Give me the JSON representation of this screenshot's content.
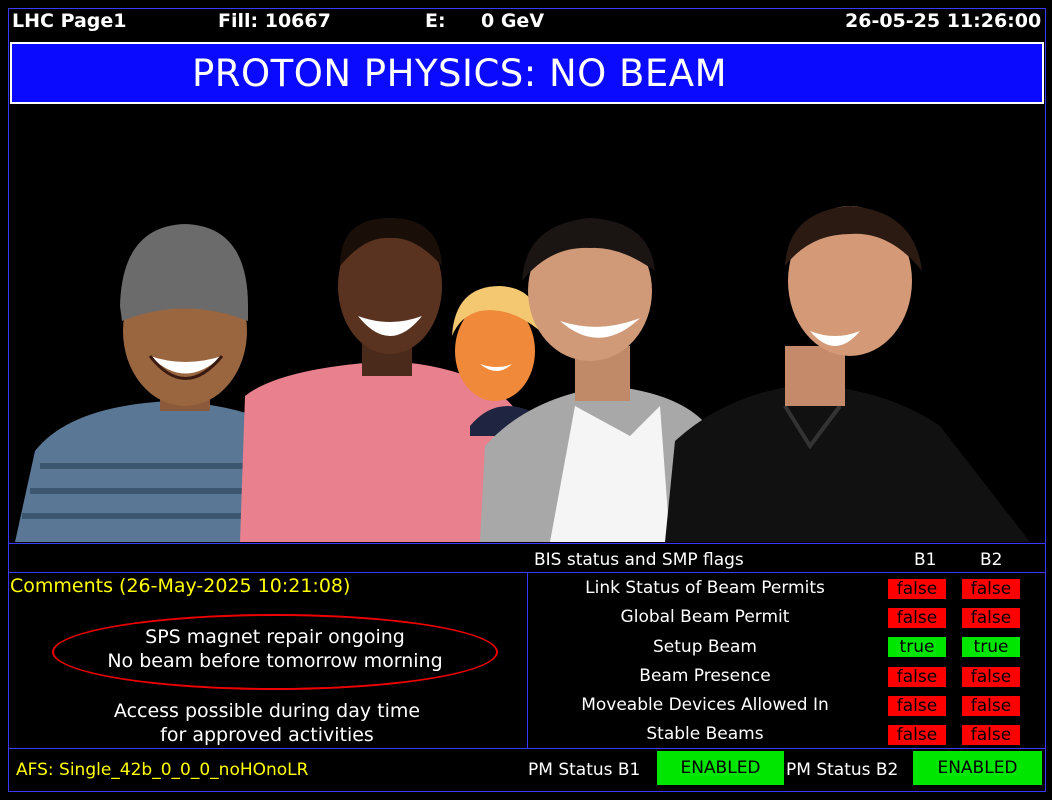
{
  "header": {
    "page": "LHC Page1",
    "fill": "Fill: 10667",
    "energy_label": "E:",
    "energy_value": "0 GeV",
    "datetime": "26-05-25 11:26:00"
  },
  "banner": {
    "title": "PROTON PHYSICS: NO BEAM"
  },
  "bis": {
    "title": "BIS status and SMP flags",
    "col_b1": "B1",
    "col_b2": "B2",
    "rows": [
      {
        "label": "Link Status of Beam Permits",
        "b1": "false",
        "b2": "false"
      },
      {
        "label": "Global Beam Permit",
        "b1": "false",
        "b2": "false"
      },
      {
        "label": "Setup Beam",
        "b1": "true",
        "b2": "true"
      },
      {
        "label": "Beam Presence",
        "b1": "false",
        "b2": "false"
      },
      {
        "label": "Moveable Devices Allowed In",
        "b1": "false",
        "b2": "false"
      },
      {
        "label": "Stable Beams",
        "b1": "false",
        "b2": "false"
      }
    ]
  },
  "comments": {
    "heading": "Comments (26-May-2025 10:21:08)",
    "line1": "SPS magnet repair ongoing",
    "line2": "No beam before tomorrow morning",
    "line3": "Access possible during day time",
    "line4": "for approved activities"
  },
  "footer": {
    "afs": "AFS: Single_42b_0_0_0_noHOnoLR",
    "pm_b1_label": "PM Status B1",
    "pm_b1_value": "ENABLED",
    "pm_b2_label": "PM Status B2",
    "pm_b2_value": "ENABLED"
  },
  "colors": {
    "banner": "#0a0aff",
    "frame": "#3a3aff",
    "false_flag": "#ff0000",
    "true_flag": "#00e600",
    "comment_heading": "#ffff00"
  }
}
